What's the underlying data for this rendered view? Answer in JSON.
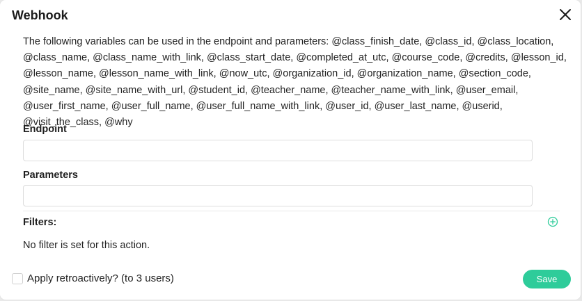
{
  "dialog": {
    "title": "Webhook",
    "close_icon": "close-icon",
    "description": "The following variables can be used in the endpoint and parameters: @class_finish_date, @class_id, @class_location, @class_name, @class_name_with_link, @class_start_date, @completed_at_utc, @course_code, @credits, @lesson_id, @lesson_name, @lesson_name_with_link, @now_utc, @organization_id, @organization_name, @section_code, @site_name, @site_name_with_url, @student_id, @teacher_name, @teacher_name_with_link, @user_email, @user_first_name, @user_full_name, @user_full_name_with_link, @user_id, @user_last_name, @userid, @visit_the_class, @why"
  },
  "endpoint": {
    "label": "Endpoint",
    "value": ""
  },
  "parameters": {
    "label": "Parameters",
    "value": ""
  },
  "filters": {
    "label": "Filters:",
    "add_icon": "plus-circle-icon",
    "empty_text": "No filter is set for this action."
  },
  "footer": {
    "retro_label": "Apply retroactively? (to 3 users)",
    "retro_checked": false,
    "save_label": "Save"
  },
  "colors": {
    "accent": "#2ecc9a",
    "text": "#222222",
    "border": "#dcdcdc"
  }
}
